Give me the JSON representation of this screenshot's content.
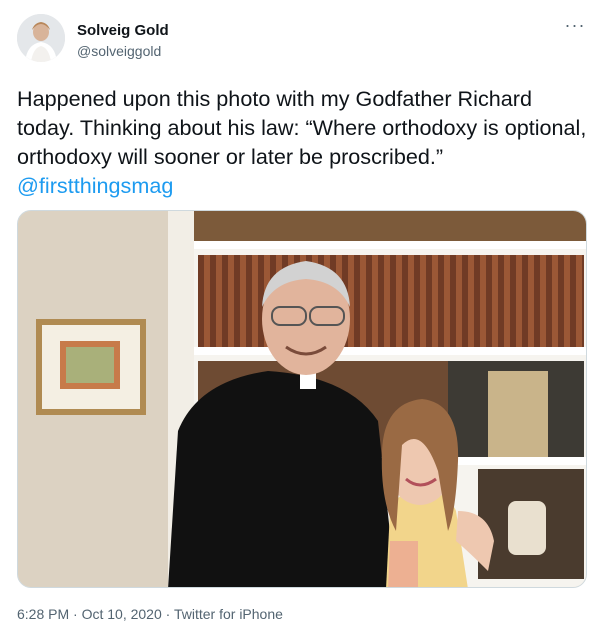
{
  "user": {
    "name": "Solveig Gold",
    "handle": "@solveiggold"
  },
  "menu": {
    "more_label": "···"
  },
  "tweet": {
    "text": "Happened upon this photo with my Godfather Richard today. Thinking about his law: “Where orthodoxy is optional, orthodoxy will sooner or later be proscribed.”",
    "mention": "@firstthingsmag"
  },
  "meta": {
    "time": "6:28 PM",
    "sep1": " · ",
    "date": "Oct 10, 2020",
    "sep2": " · ",
    "source": "Twitter for iPhone"
  },
  "colors": {
    "link": "#1d9bf0",
    "secondary_text": "#536471"
  }
}
